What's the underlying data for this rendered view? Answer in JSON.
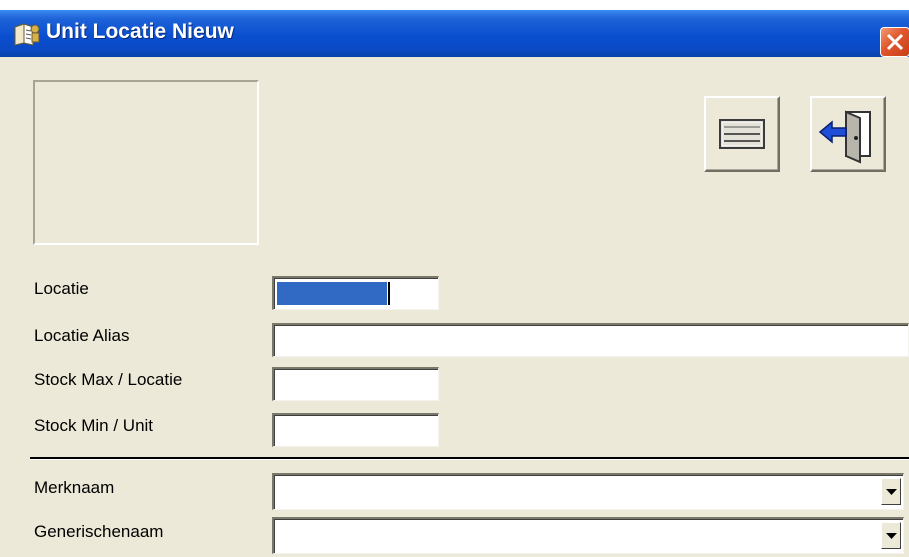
{
  "window": {
    "title": "Unit Locatie Nieuw",
    "icon": "form-icon",
    "close_icon": "close-icon"
  },
  "toolbar": {
    "save_icon": "save-record-icon",
    "exit_icon": "exit-door-icon"
  },
  "form": {
    "fields": [
      {
        "label": "Locatie",
        "value": "",
        "selected": true
      },
      {
        "label": "Locatie Alias",
        "value": ""
      },
      {
        "label": "Stock Max / Locatie",
        "value": ""
      },
      {
        "label": "Stock Min / Unit",
        "value": ""
      }
    ],
    "combos": [
      {
        "label": "Merknaam",
        "value": ""
      },
      {
        "label": "Generischenaam",
        "value": ""
      }
    ]
  },
  "colors": {
    "titlebar": "#0a4fd0",
    "window_bg": "#ece9d8",
    "selection": "#316ac5",
    "close_button": "#e1562c"
  }
}
